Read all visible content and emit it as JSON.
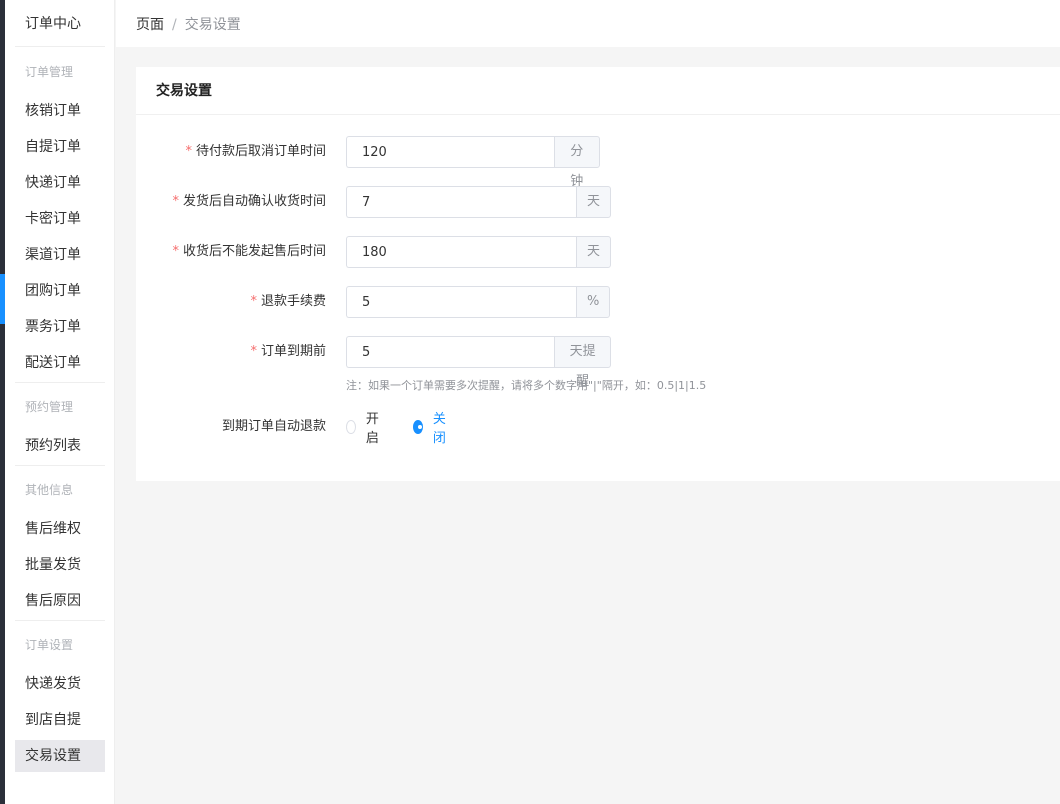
{
  "colors": {
    "accent": "#1890ff",
    "required": "#f56c6c",
    "sidebar_dark": "#2b2f3a"
  },
  "sidebar": {
    "app_title": "订单中心",
    "groups": [
      {
        "title": "订单管理",
        "items": [
          "核销订单",
          "自提订单",
          "快递订单",
          "卡密订单",
          "渠道订单",
          "团购订单",
          "票务订单",
          "配送订单"
        ]
      },
      {
        "title": "预约管理",
        "items": [
          "预约列表"
        ]
      },
      {
        "title": "其他信息",
        "items": [
          "售后维权",
          "批量发货",
          "售后原因"
        ]
      },
      {
        "title": "订单设置",
        "items": [
          "快递发货",
          "到店自提",
          "交易设置"
        ]
      }
    ],
    "active_item": "交易设置"
  },
  "breadcrumb": {
    "home": "页面",
    "separator": "/",
    "current": "交易设置"
  },
  "card": {
    "title": "交易设置",
    "fields": [
      {
        "label": "待付款后取消订单时间",
        "required": true,
        "value": "120",
        "suffix": "分钟"
      },
      {
        "label": "发货后自动确认收货时间",
        "required": true,
        "value": "7",
        "suffix": "天"
      },
      {
        "label": "收货后不能发起售后时间",
        "required": true,
        "value": "180",
        "suffix": "天"
      },
      {
        "label": "退款手续费",
        "required": true,
        "value": "5",
        "suffix": "%"
      },
      {
        "label": "订单到期前",
        "required": true,
        "value": "5",
        "suffix": "天提醒"
      }
    ],
    "hint": "注：如果一个订单需要多次提醒，请将多个数字用\"|\"隔开，如：0.5|1|1.5",
    "auto_refund": {
      "label": "到期订单自动退款",
      "options": [
        "开启",
        "关闭"
      ],
      "selected": "关闭"
    }
  }
}
